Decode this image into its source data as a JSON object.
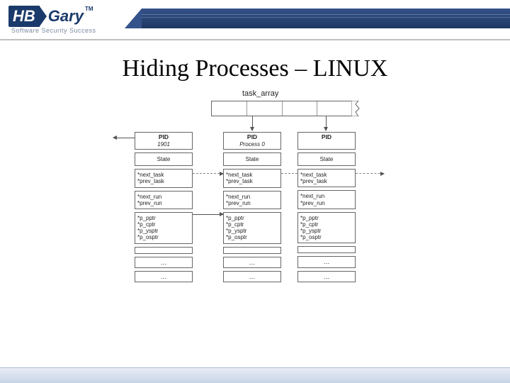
{
  "brand": {
    "hb": "HB",
    "gary": "Gary",
    "tm": "TM",
    "tagline": "Software Security Success"
  },
  "title": "Hiding Processes – LINUX",
  "task_array_label": "task_array",
  "columns": [
    {
      "pid_label": "PID",
      "pid_sub": "1901",
      "state": "State",
      "taskptrs": [
        "*next_task",
        "*prev_task"
      ],
      "runptrs": [
        "*next_run",
        "*prev_run"
      ],
      "pptrs": [
        "*p_pptr",
        "*p_cptr",
        "*p_ysptr",
        "*p_osptr"
      ],
      "dots": "…"
    },
    {
      "pid_label": "PID",
      "pid_sub": "Process 0",
      "state": "State",
      "taskptrs": [
        "*next_task",
        "*prev_task"
      ],
      "runptrs": [
        "*next_run",
        "*prev_run"
      ],
      "pptrs": [
        "*p_pptr",
        "*p_cptr",
        "*p_ysptr",
        "*p_osptr"
      ],
      "dots": "…"
    },
    {
      "pid_label": "PID",
      "pid_sub": "",
      "state": "State",
      "taskptrs": [
        "*next_task",
        "*prev_task"
      ],
      "runptrs": [
        "*next_run",
        "*prev_run"
      ],
      "pptrs": [
        "*p_pptr",
        "*p_cptr",
        "*p_ysptr",
        "*p_osptr"
      ],
      "dots": "…"
    }
  ]
}
